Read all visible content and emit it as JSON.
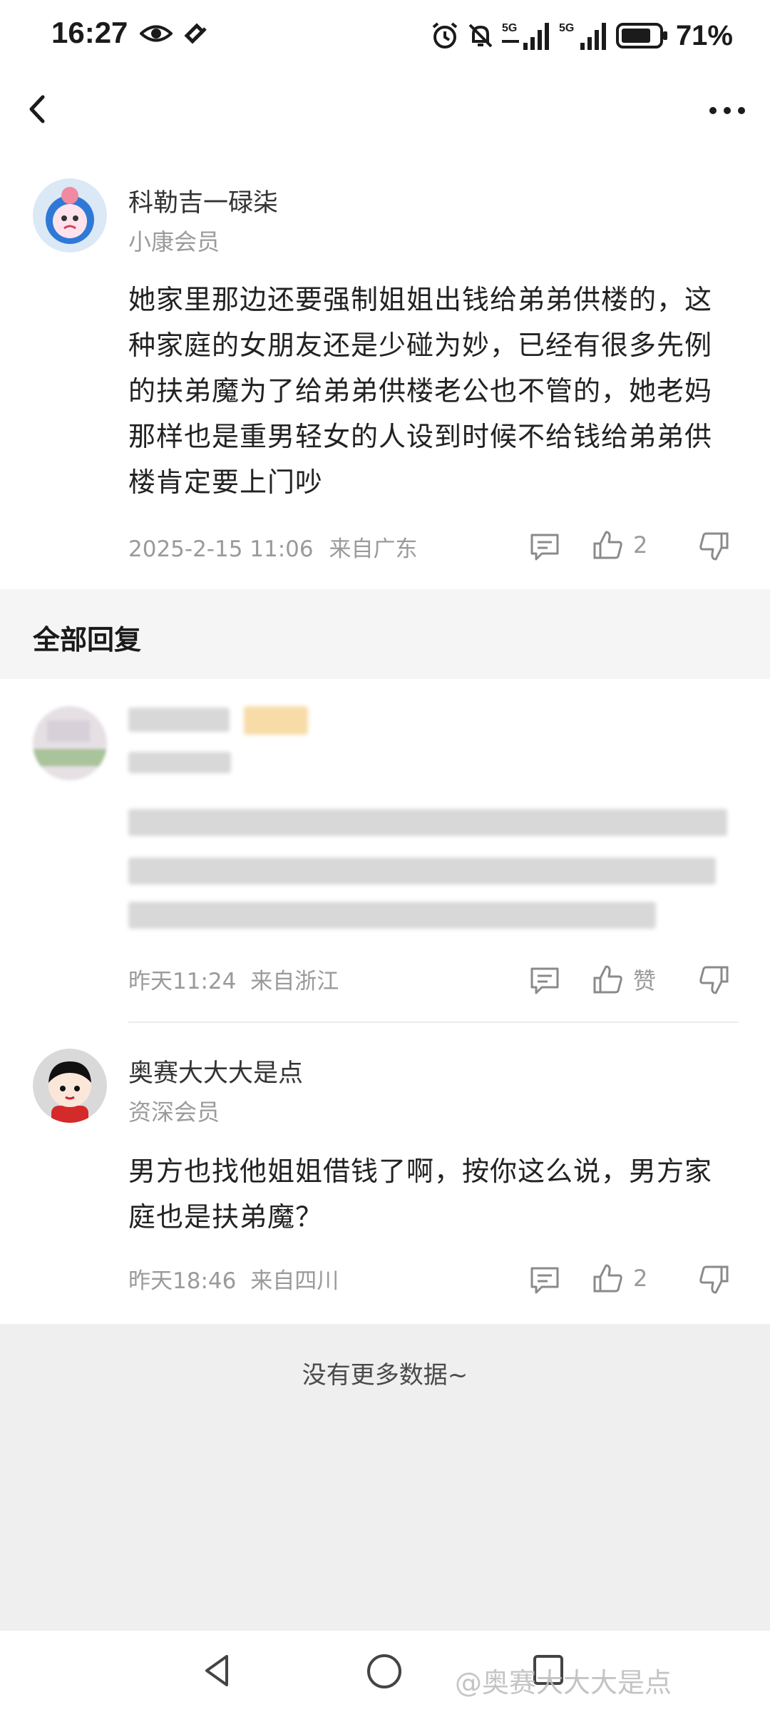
{
  "status_bar": {
    "time": "16:27",
    "battery": "71%",
    "signal_labels": [
      "5G",
      "5G"
    ]
  },
  "nav": {
    "back_icon": "chevron-left-icon",
    "more_icon": "more-horizontal-icon"
  },
  "main_comment": {
    "username": "科勒吉一碌柒",
    "member_level": "小康会员",
    "content": "她家里那边还要强制姐姐出钱给弟弟供楼的，这种家庭的女朋友还是少碰为妙，已经有很多先例的扶弟魔为了给弟弟供楼老公也不管的，她老妈那样也是重男轻女的人设到时候不给钱给弟弟供楼肯定要上门吵",
    "timestamp": "2025-2-15 11:06",
    "location": "来自广东",
    "likes": "2"
  },
  "replies_section": {
    "title": "全部回复"
  },
  "replies": [
    {
      "timestamp": "昨天11:24",
      "location": "来自浙江",
      "like_label": "赞"
    },
    {
      "username": "奥赛大大大是点",
      "member_level": "资深会员",
      "content": "男方也找他姐姐借钱了啊，按你这么说，男方家庭也是扶弟魔？",
      "timestamp": "昨天18:46",
      "location": "来自四川",
      "likes": "2"
    }
  ],
  "footer": {
    "no_more": "没有更多数据~"
  },
  "system_nav": {
    "watermark": "@奥赛大大大是点"
  },
  "colors": {
    "text_primary": "#222222",
    "text_secondary": "#9a9a9a",
    "section_bg": "#f5f5f5",
    "footer_bg": "#efefef"
  }
}
